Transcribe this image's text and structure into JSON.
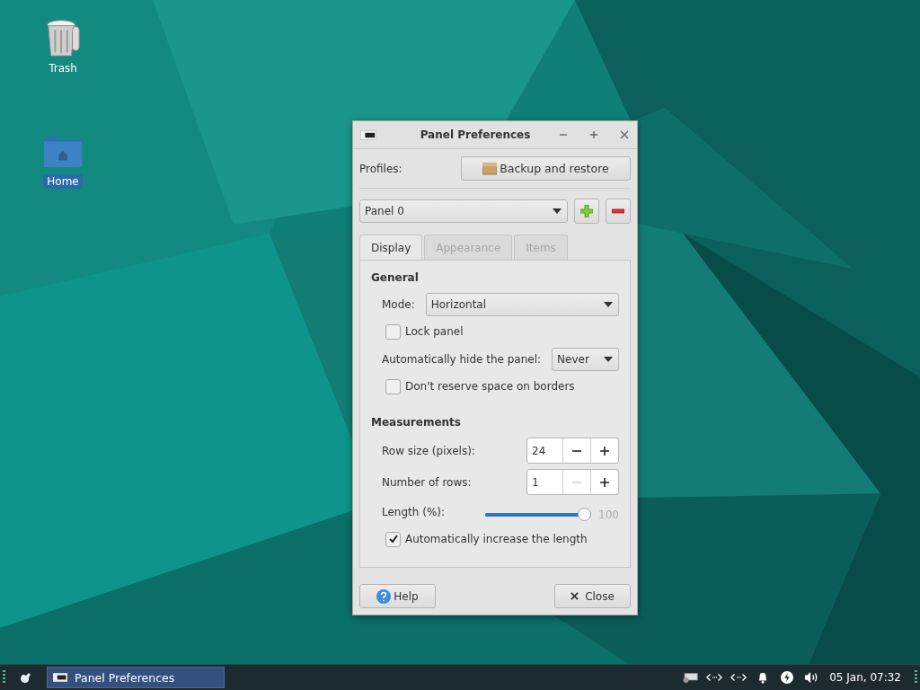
{
  "desktop": {
    "icons": [
      {
        "label": "Trash",
        "kind": "trash",
        "selected": false
      },
      {
        "label": "Home",
        "kind": "folder",
        "selected": true
      }
    ]
  },
  "window": {
    "title": "Panel Preferences",
    "profiles": {
      "label": "Profiles:",
      "button": "Backup and restore"
    },
    "panel_select": {
      "value": "Panel 0"
    },
    "tabs": [
      {
        "label": "Display",
        "selected": true
      },
      {
        "label": "Appearance",
        "selected": false
      },
      {
        "label": "Items",
        "selected": false
      }
    ],
    "general": {
      "heading": "General",
      "rows": [
        {
          "kind": "combo",
          "label": "Mode:",
          "value": "Horizontal"
        },
        {
          "kind": "check",
          "label": "Lock panel",
          "checked": false
        },
        {
          "kind": "combo",
          "label": "Automatically hide the panel:",
          "value": "Never"
        },
        {
          "kind": "check",
          "label": "Don't reserve space on borders",
          "checked": false
        }
      ]
    },
    "measurements": {
      "heading": "Measurements",
      "rows": [
        {
          "kind": "spin",
          "label": "Row size (pixels):",
          "value": "24",
          "minus_disabled": false
        },
        {
          "kind": "spin",
          "label": "Number of rows:",
          "value": "1",
          "minus_disabled": true
        },
        {
          "kind": "slider",
          "label": "Length (%):",
          "level": 1,
          "reading": "100"
        },
        {
          "kind": "check",
          "label": "Automatically increase the length",
          "checked": true
        }
      ]
    },
    "buttons": [
      {
        "kind": "help",
        "label": "Help"
      },
      {
        "kind": "close",
        "label": "Close"
      }
    ]
  },
  "taskbar": {
    "tasks": [
      {
        "label": "Panel Preferences",
        "selected": true
      }
    ],
    "clock": "05 Jan, 07:32"
  }
}
